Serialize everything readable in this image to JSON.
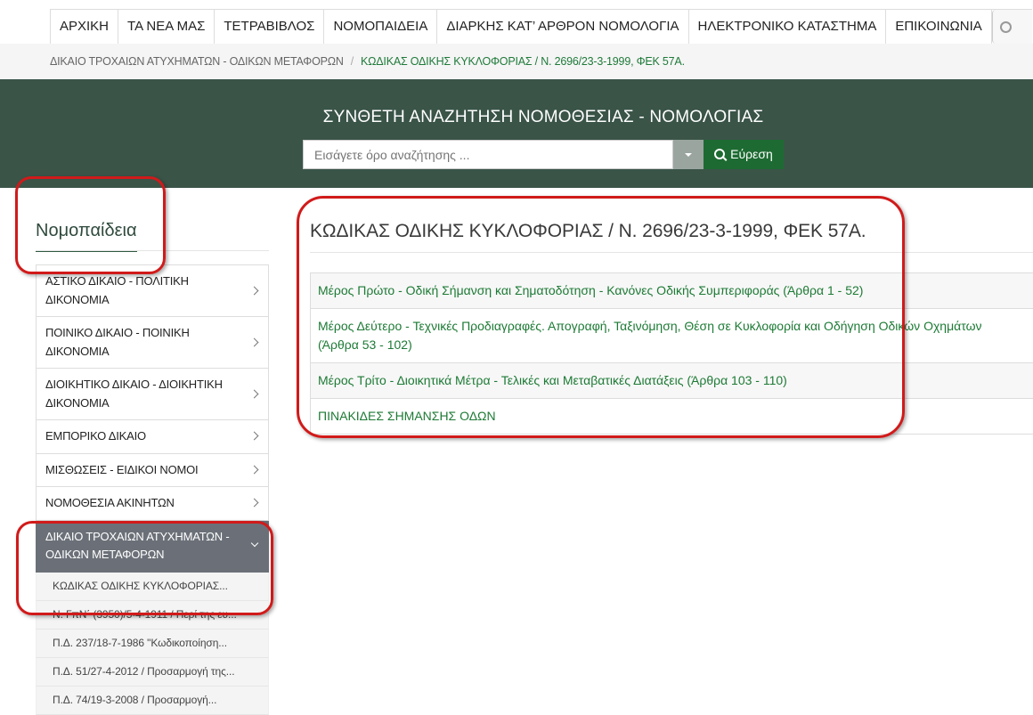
{
  "nav": {
    "items": [
      "ΑΡΧΙΚΗ",
      "ΤΑ ΝΕΑ ΜΑΣ",
      "ΤΕΤΡΑΒΙΒΛΟΣ",
      "ΝΟΜΟΠΑΙΔΕΙΑ",
      "ΔΙΑΡΚΗΣ ΚΑΤ’ ΑΡΘΡΟΝ ΝΟΜΟΛΟΓΙΑ",
      "ΗΛΕΚΤΡΟΝΙΚΟ ΚΑΤΑΣΤΗΜΑ",
      "ΕΠΙΚΟΙΝΩΝΙΑ"
    ]
  },
  "breadcrumb": {
    "parent": "ΔΙΚΑΙΟ ΤΡΟΧΑΙΩΝ ΑΤΥΧΗΜΑΤΩΝ - ΟΔΙΚΩΝ ΜΕΤΑΦΟΡΩΝ",
    "separator": "/",
    "current": "ΚΩΔΙΚΑΣ ΟΔΙΚΗΣ ΚΥΚΛΟΦΟΡΙΑΣ / Ν. 2696/23-3-1999, ΦΕΚ 57Α."
  },
  "hero": {
    "title": "ΣΥΝΘΕΤΗ ΑΝΑΖΗΤΗΣΗ ΝΟΜΟΘΕΣΙΑΣ - ΝΟΜΟΛΟΓΙΑΣ",
    "search_placeholder": "Εισάγετε όρο αναζήτησης ...",
    "search_button": "Εύρεση"
  },
  "sidebar": {
    "title": "Νομοπαίδεια",
    "items": [
      "ΑΣΤΙΚΟ ΔΙΚΑΙΟ - ΠΟΛΙΤΙΚΗ ΔΙΚΟΝΟΜΙΑ",
      "ΠΟΙΝΙΚΟ ΔΙΚΑΙΟ - ΠΟΙΝΙΚΗ ΔΙΚΟΝΟΜΙΑ",
      "ΔΙΟΙΚΗΤΙΚΟ ΔΙΚΑΙΟ - ΔΙΟΙΚΗΤΙΚΗ ΔΙΚΟΝΟΜΙΑ",
      "ΕΜΠΟΡΙΚΟ ΔΙΚΑΙΟ",
      "ΜΙΣΘΩΣΕΙΣ - ΕΙΔΙΚΟΙ ΝΟΜΟΙ",
      "ΝΟΜΟΘΕΣΙΑ ΑΚΙΝΗΤΩΝ"
    ],
    "active_item": "ΔΙΚΑΙΟ ΤΡΟΧΑΙΩΝ ΑΤΥΧΗΜΑΤΩΝ - ΟΔΙΚΩΝ ΜΕΤΑΦΟΡΩΝ",
    "sub_items": [
      "ΚΩΔΙΚΑΣ ΟΔΙΚΗΣ ΚΥΚΛΟΦΟΡΙΑΣ...",
      "Ν. ΓπΝ΄ (3950)/5-4-1911 / Περί της ευ...",
      "Π.Δ. 237/18-7-1986 \"Κωδικοποίηση...",
      "Π.Δ. 51/27-4-2012 / Προσαρμογή της...",
      "Π.Δ. 74/19-3-2008 / Προσαρμογή..."
    ]
  },
  "main": {
    "title": "ΚΩΔΙΚΑΣ ΟΔΙΚΗΣ ΚΥΚΛΟΦΟΡΙΑΣ / Ν. 2696/23-3-1999, ΦΕΚ 57Α.",
    "rows": [
      "Μέρος Πρώτο - Οδική Σήμανση και Σηματοδότηση - Κανόνες Οδικής Συμπεριφοράς (Άρθρα 1 - 52)",
      "Μέρος Δεύτερο - Τεχνικές Προδιαγραφές. Απογραφή, Ταξινόμηση, Θέση σε Κυκλοφορία και Οδήγηση Οδικών Οχημάτων (Άρθρα 53 - 102)",
      "Μέρος Τρίτο - Διοικητικά Μέτρα - Τελικές και Μεταβατικές Διατάξεις (Άρθρα 103 - 110)",
      "ΠΙΝΑΚΙΔΕΣ ΣΗΜΑΝΣΗΣ ΟΔΩΝ"
    ]
  },
  "colors": {
    "hero_bg": "#3a5448",
    "accent_green": "#1d6b32",
    "link_green": "#1d7a35",
    "active_bg": "#6b7078",
    "annotation_red": "#d11a1a"
  }
}
